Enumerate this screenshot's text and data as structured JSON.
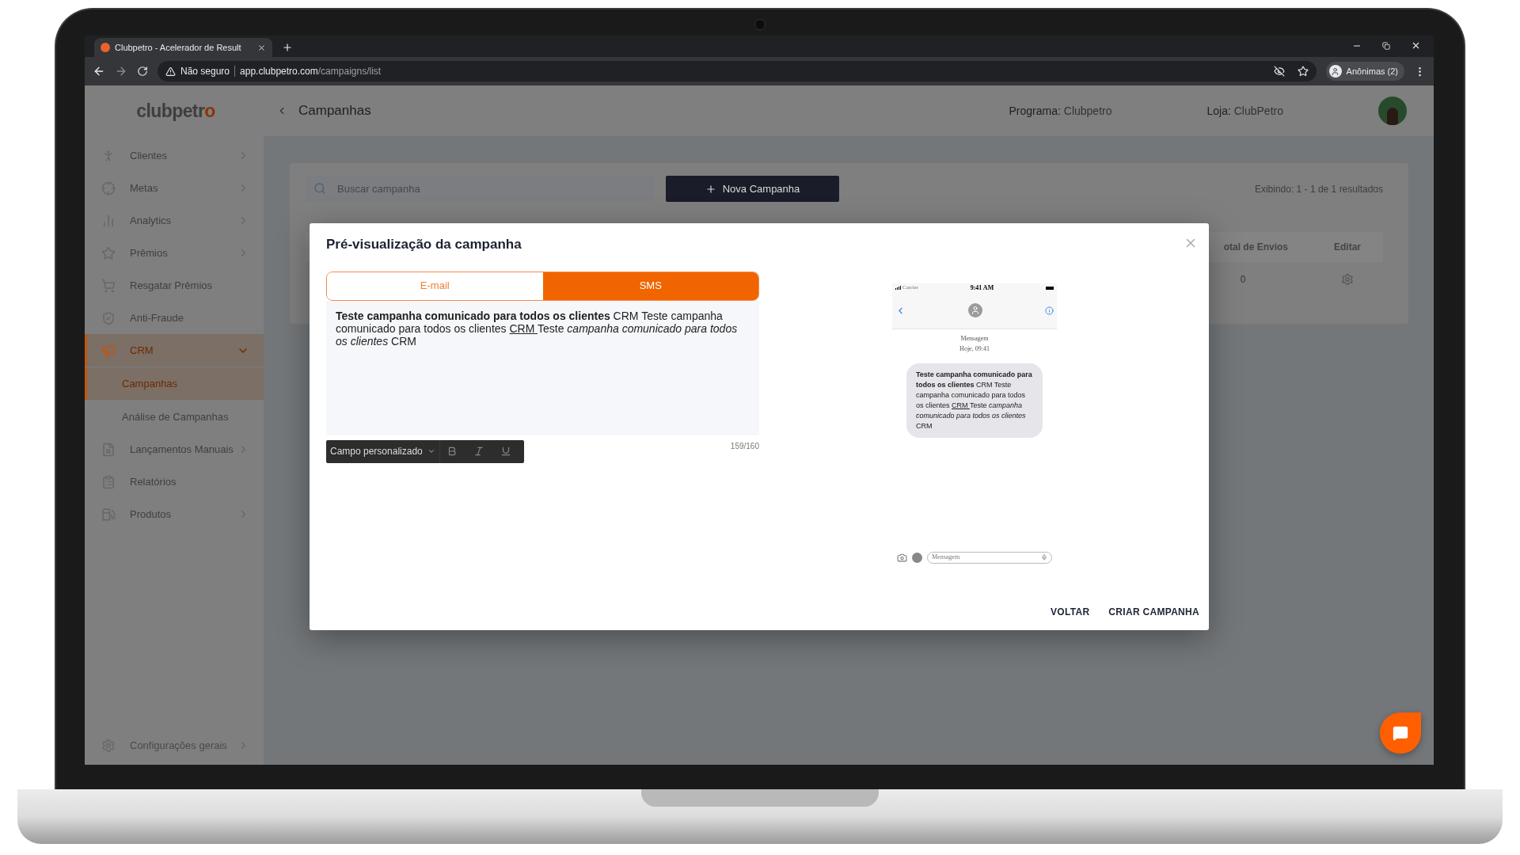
{
  "browser": {
    "tab_title": "Clubpetro - Acelerador de Result",
    "security": "Não seguro",
    "url_host": "app.clubpetro.com",
    "url_path": "/campaigns/list",
    "profile": "Anônimas (2)"
  },
  "logo": {
    "main": "clubpetr",
    "accent": "o"
  },
  "header": {
    "title": "Campanhas",
    "program_label": "Programa:",
    "program_value": "Clubpetro",
    "store_label": "Loja:",
    "store_value": "ClubPetro"
  },
  "sidebar": {
    "items": [
      {
        "label": "Clientes",
        "kind": "group",
        "expanded": false,
        "selected": false
      },
      {
        "label": "Metas",
        "kind": "group",
        "expanded": false,
        "selected": false
      },
      {
        "label": "Analytics",
        "kind": "group",
        "expanded": false,
        "selected": false
      },
      {
        "label": "Prêmios",
        "kind": "group",
        "expanded": false,
        "selected": false
      },
      {
        "label": "Resgatar Prêmios",
        "kind": "link",
        "selected": false
      },
      {
        "label": "Anti-Fraude",
        "kind": "link",
        "selected": false
      },
      {
        "label": "CRM",
        "kind": "group",
        "expanded": true,
        "selected": true,
        "children": [
          {
            "label": "Campanhas",
            "selected": true
          },
          {
            "label": "Análise de Campanhas",
            "selected": false
          }
        ]
      },
      {
        "label": "Lançamentos Manuais",
        "kind": "group",
        "expanded": false,
        "selected": false
      },
      {
        "label": "Relatórios",
        "kind": "link",
        "selected": false
      },
      {
        "label": "Produtos",
        "kind": "group",
        "expanded": false,
        "selected": false
      }
    ],
    "footer": {
      "label": "Configurações gerais"
    }
  },
  "list": {
    "search_placeholder": "Buscar campanha",
    "new_button": "Nova Campanha",
    "results": "Exibindo: 1 - 1 de 1 resultados",
    "columns": [
      "otal de Envios",
      "Editar"
    ],
    "rows": [
      {
        "total": "0"
      }
    ]
  },
  "modal": {
    "title": "Pré-visualização da campanha",
    "tabs": [
      {
        "label": "E-mail",
        "selected": false
      },
      {
        "label": "SMS",
        "selected": true
      }
    ],
    "editor": [
      {
        "kind": "bold",
        "text": "Teste campanha comunicado para todos os clientes"
      },
      {
        "kind": "plain",
        "text": " CRM Teste campanha comunicado para todos os clientes "
      },
      {
        "kind": "underline",
        "text": "CRM "
      },
      {
        "kind": "plain",
        "text": "Teste "
      },
      {
        "kind": "italic",
        "text": "campanha comunicado para todos os clientes"
      },
      {
        "kind": "plain",
        "text": " CRM"
      }
    ],
    "toolbar": {
      "field_dropdown": "Campo personalizado"
    },
    "counter": "159/160",
    "phone": {
      "carrier": "Carrier",
      "time": "9:41 AM",
      "thread_label": "Mensagem",
      "thread_time": "Hoje, 09:41",
      "bubble": [
        {
          "kind": "bold",
          "text": "Teste campanha comunicado para todos os clientes"
        },
        {
          "kind": "plain",
          "text": " CRM Teste campanha comunicado para todos os clientes "
        },
        {
          "kind": "underline",
          "text": "CRM "
        },
        {
          "kind": "plain",
          "text": "Teste "
        },
        {
          "kind": "italic",
          "text": "campanha comunicado para todos os clientes"
        },
        {
          "kind": "plain",
          "text": " CRM"
        }
      ],
      "input_placeholder": "Mensagem"
    },
    "buttons": [
      "VOLTAR",
      "CRIAR CAMPANHA"
    ]
  }
}
